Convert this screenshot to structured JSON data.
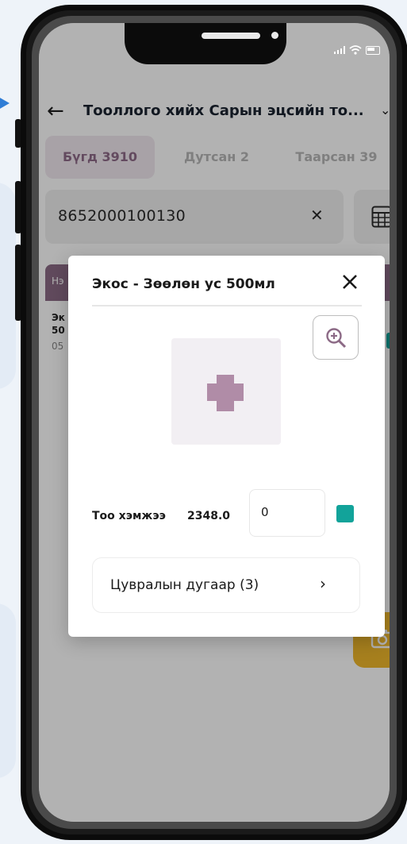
{
  "status_bar": {
    "icons": [
      "signal-icon",
      "wifi-icon",
      "battery-icon"
    ]
  },
  "header": {
    "back_icon": "back-arrow-icon",
    "title": "Тооллого хийх Сарын эцсийн то...",
    "dropdown_icon": "chevron-down-icon"
  },
  "tabs": [
    {
      "label": "Бүгд 3910",
      "active": true
    },
    {
      "label": "Дутсан 2",
      "active": false
    },
    {
      "label": "Таарсан 39",
      "active": false
    }
  ],
  "search": {
    "value": "8652000100130",
    "clear_icon": "close-icon",
    "calculator_icon": "calculator-icon"
  },
  "list": {
    "header_label": "Нэ",
    "item": {
      "line1": "Эк",
      "line2": "50",
      "line3": "05"
    }
  },
  "fab": {
    "icon": "camera-icon"
  },
  "modal": {
    "title": "Экос - Зөөлөн ус 500мл",
    "close_icon": "close-icon",
    "zoom_icon": "zoom-in-icon",
    "image_icon": "plus-icon",
    "quantity_label": "Тоо хэмжээ",
    "stock_value": "2348.0",
    "quantity_input_value": "0",
    "serial_button_label": "Цувралын дугаар (3)",
    "serial_chevron": "›"
  },
  "colors": {
    "accent_purple": "#8c6a86",
    "teal": "#12a39a",
    "fab_yellow": "#f0b82c",
    "tab_active_bg": "#f1e9f0"
  }
}
